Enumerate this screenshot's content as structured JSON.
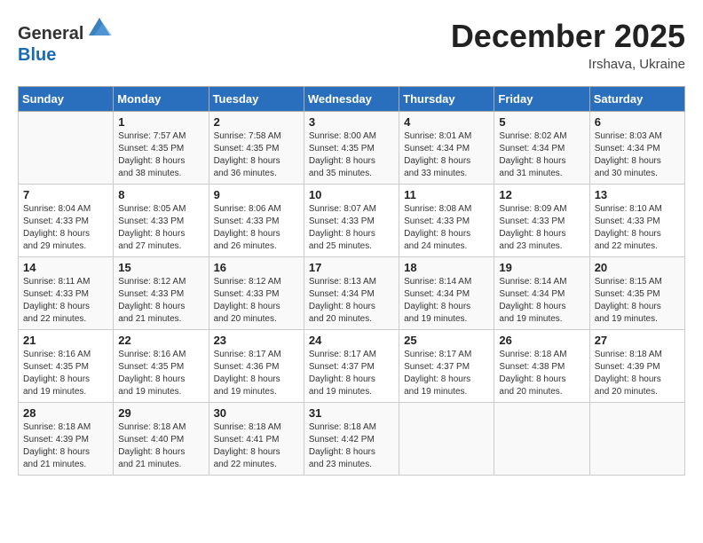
{
  "header": {
    "logo_line1": "General",
    "logo_line2": "Blue",
    "month_title": "December 2025",
    "location": "Irshava, Ukraine"
  },
  "days_of_week": [
    "Sunday",
    "Monday",
    "Tuesday",
    "Wednesday",
    "Thursday",
    "Friday",
    "Saturday"
  ],
  "weeks": [
    [
      {
        "num": "",
        "info": ""
      },
      {
        "num": "1",
        "info": "Sunrise: 7:57 AM\nSunset: 4:35 PM\nDaylight: 8 hours\nand 38 minutes."
      },
      {
        "num": "2",
        "info": "Sunrise: 7:58 AM\nSunset: 4:35 PM\nDaylight: 8 hours\nand 36 minutes."
      },
      {
        "num": "3",
        "info": "Sunrise: 8:00 AM\nSunset: 4:35 PM\nDaylight: 8 hours\nand 35 minutes."
      },
      {
        "num": "4",
        "info": "Sunrise: 8:01 AM\nSunset: 4:34 PM\nDaylight: 8 hours\nand 33 minutes."
      },
      {
        "num": "5",
        "info": "Sunrise: 8:02 AM\nSunset: 4:34 PM\nDaylight: 8 hours\nand 31 minutes."
      },
      {
        "num": "6",
        "info": "Sunrise: 8:03 AM\nSunset: 4:34 PM\nDaylight: 8 hours\nand 30 minutes."
      }
    ],
    [
      {
        "num": "7",
        "info": "Sunrise: 8:04 AM\nSunset: 4:33 PM\nDaylight: 8 hours\nand 29 minutes."
      },
      {
        "num": "8",
        "info": "Sunrise: 8:05 AM\nSunset: 4:33 PM\nDaylight: 8 hours\nand 27 minutes."
      },
      {
        "num": "9",
        "info": "Sunrise: 8:06 AM\nSunset: 4:33 PM\nDaylight: 8 hours\nand 26 minutes."
      },
      {
        "num": "10",
        "info": "Sunrise: 8:07 AM\nSunset: 4:33 PM\nDaylight: 8 hours\nand 25 minutes."
      },
      {
        "num": "11",
        "info": "Sunrise: 8:08 AM\nSunset: 4:33 PM\nDaylight: 8 hours\nand 24 minutes."
      },
      {
        "num": "12",
        "info": "Sunrise: 8:09 AM\nSunset: 4:33 PM\nDaylight: 8 hours\nand 23 minutes."
      },
      {
        "num": "13",
        "info": "Sunrise: 8:10 AM\nSunset: 4:33 PM\nDaylight: 8 hours\nand 22 minutes."
      }
    ],
    [
      {
        "num": "14",
        "info": "Sunrise: 8:11 AM\nSunset: 4:33 PM\nDaylight: 8 hours\nand 22 minutes."
      },
      {
        "num": "15",
        "info": "Sunrise: 8:12 AM\nSunset: 4:33 PM\nDaylight: 8 hours\nand 21 minutes."
      },
      {
        "num": "16",
        "info": "Sunrise: 8:12 AM\nSunset: 4:33 PM\nDaylight: 8 hours\nand 20 minutes."
      },
      {
        "num": "17",
        "info": "Sunrise: 8:13 AM\nSunset: 4:34 PM\nDaylight: 8 hours\nand 20 minutes."
      },
      {
        "num": "18",
        "info": "Sunrise: 8:14 AM\nSunset: 4:34 PM\nDaylight: 8 hours\nand 19 minutes."
      },
      {
        "num": "19",
        "info": "Sunrise: 8:14 AM\nSunset: 4:34 PM\nDaylight: 8 hours\nand 19 minutes."
      },
      {
        "num": "20",
        "info": "Sunrise: 8:15 AM\nSunset: 4:35 PM\nDaylight: 8 hours\nand 19 minutes."
      }
    ],
    [
      {
        "num": "21",
        "info": "Sunrise: 8:16 AM\nSunset: 4:35 PM\nDaylight: 8 hours\nand 19 minutes."
      },
      {
        "num": "22",
        "info": "Sunrise: 8:16 AM\nSunset: 4:35 PM\nDaylight: 8 hours\nand 19 minutes."
      },
      {
        "num": "23",
        "info": "Sunrise: 8:17 AM\nSunset: 4:36 PM\nDaylight: 8 hours\nand 19 minutes."
      },
      {
        "num": "24",
        "info": "Sunrise: 8:17 AM\nSunset: 4:37 PM\nDaylight: 8 hours\nand 19 minutes."
      },
      {
        "num": "25",
        "info": "Sunrise: 8:17 AM\nSunset: 4:37 PM\nDaylight: 8 hours\nand 19 minutes."
      },
      {
        "num": "26",
        "info": "Sunrise: 8:18 AM\nSunset: 4:38 PM\nDaylight: 8 hours\nand 20 minutes."
      },
      {
        "num": "27",
        "info": "Sunrise: 8:18 AM\nSunset: 4:39 PM\nDaylight: 8 hours\nand 20 minutes."
      }
    ],
    [
      {
        "num": "28",
        "info": "Sunrise: 8:18 AM\nSunset: 4:39 PM\nDaylight: 8 hours\nand 21 minutes."
      },
      {
        "num": "29",
        "info": "Sunrise: 8:18 AM\nSunset: 4:40 PM\nDaylight: 8 hours\nand 21 minutes."
      },
      {
        "num": "30",
        "info": "Sunrise: 8:18 AM\nSunset: 4:41 PM\nDaylight: 8 hours\nand 22 minutes."
      },
      {
        "num": "31",
        "info": "Sunrise: 8:18 AM\nSunset: 4:42 PM\nDaylight: 8 hours\nand 23 minutes."
      },
      {
        "num": "",
        "info": ""
      },
      {
        "num": "",
        "info": ""
      },
      {
        "num": "",
        "info": ""
      }
    ]
  ]
}
